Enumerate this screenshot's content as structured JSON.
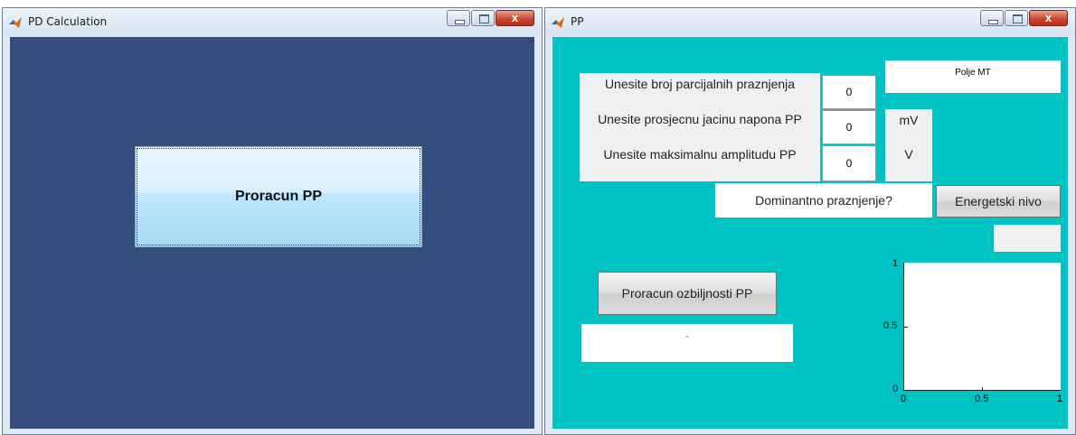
{
  "window1": {
    "title": "PD Calculation",
    "button_label": "Proracun PP",
    "close_glyph": "x"
  },
  "window2": {
    "title": "PP",
    "close_glyph": "x",
    "labels": {
      "broj": "Unesite broj parcijalnih praznjenja",
      "prosjecna": "Unesite prosjecnu jacinu napona PP",
      "maksimalna": "Unesite maksimalnu amplitudu PP",
      "unit_mv": "mV",
      "unit_v": "V",
      "dominantno": "Dominantno praznjenje?"
    },
    "inputs": {
      "broj": "0",
      "prosjecna": "0",
      "maksimalna": "0"
    },
    "polje_mt": "Polje MT",
    "energetski_button": "Energetski nivo",
    "ozbiljnost_button": "Proracun ozbiljnosti PP",
    "result_text": "-",
    "energetski_result": "",
    "axes": {
      "x_ticks": [
        "0",
        "0.5",
        "1"
      ],
      "y_ticks": [
        "0",
        "0.5",
        "1"
      ],
      "xlim": [
        0,
        1
      ],
      "ylim": [
        0,
        1
      ]
    }
  }
}
